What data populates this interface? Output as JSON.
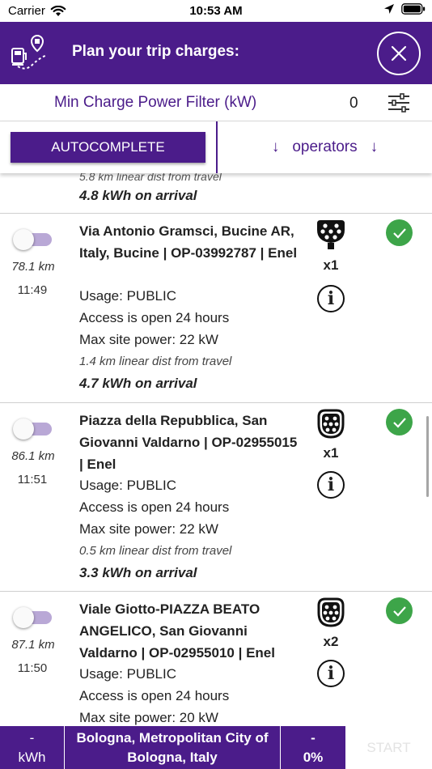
{
  "status_bar": {
    "carrier": "Carrier",
    "time": "10:53 AM"
  },
  "header": {
    "title": "Plan your trip charges:",
    "icon": "route-charging-icon",
    "close_icon": "close-icon"
  },
  "filter": {
    "label": "Min Charge Power Filter (kW)",
    "value": "0"
  },
  "actions": {
    "autocomplete_label": "AUTOCOMPLETE",
    "operators_label": "operators",
    "operators_arrow": "↓"
  },
  "partial_row": {
    "dist": "5.8 km linear dist from travel",
    "arrival": "4.8 kWh on arrival"
  },
  "stations": [
    {
      "km": "78.1 km",
      "time": "11:49",
      "name": "Via Antonio Gramsci, Bucine AR, Italy, Bucine | OP-03992787 | Enel",
      "usage": "Usage: PUBLIC",
      "access": "Access is open 24 hours",
      "power": "Max site power: 22 kW",
      "dist": "1.4 km linear dist from travel",
      "arrival": "4.7 kWh on arrival",
      "plug_icon": "type2-plug-icon",
      "count": "x1",
      "info_label": "i",
      "selected": false,
      "checked": true
    },
    {
      "km": "86.1 km",
      "time": "11:51",
      "name": "Piazza della Repubblica, San Giovanni Valdarno | OP-02955015 | Enel",
      "usage": "Usage: PUBLIC",
      "access": "Access is open 24 hours",
      "power": "Max site power: 22 kW",
      "dist": "0.5 km linear dist from travel",
      "arrival": "3.3 kWh on arrival",
      "plug_icon": "type2-socket-icon",
      "count": "x1",
      "info_label": "i",
      "selected": false,
      "checked": true
    },
    {
      "km": "87.1 km",
      "time": "11:50",
      "name": "Viale Giotto-PIAZZA BEATO ANGELICO, San Giovanni Valdarno | OP-02955010 | Enel",
      "usage": "Usage: PUBLIC",
      "access": "Access is open 24 hours",
      "power": "Max site power: 20 kW",
      "dist": "",
      "arrival": "",
      "plug_icon": "type2-socket-icon",
      "count": "x2",
      "info_label": "i",
      "selected": false,
      "checked": true
    }
  ],
  "bottom": {
    "energy_value": "-",
    "energy_unit": "kWh",
    "destination": "Bologna, Metropolitan City of Bologna, Italy",
    "percent_top": "-",
    "percent": "0%",
    "start_label": "START"
  },
  "colors": {
    "brand": "#4b1c8a",
    "check": "#3da549",
    "toggle_track": "#b9a8d6"
  }
}
